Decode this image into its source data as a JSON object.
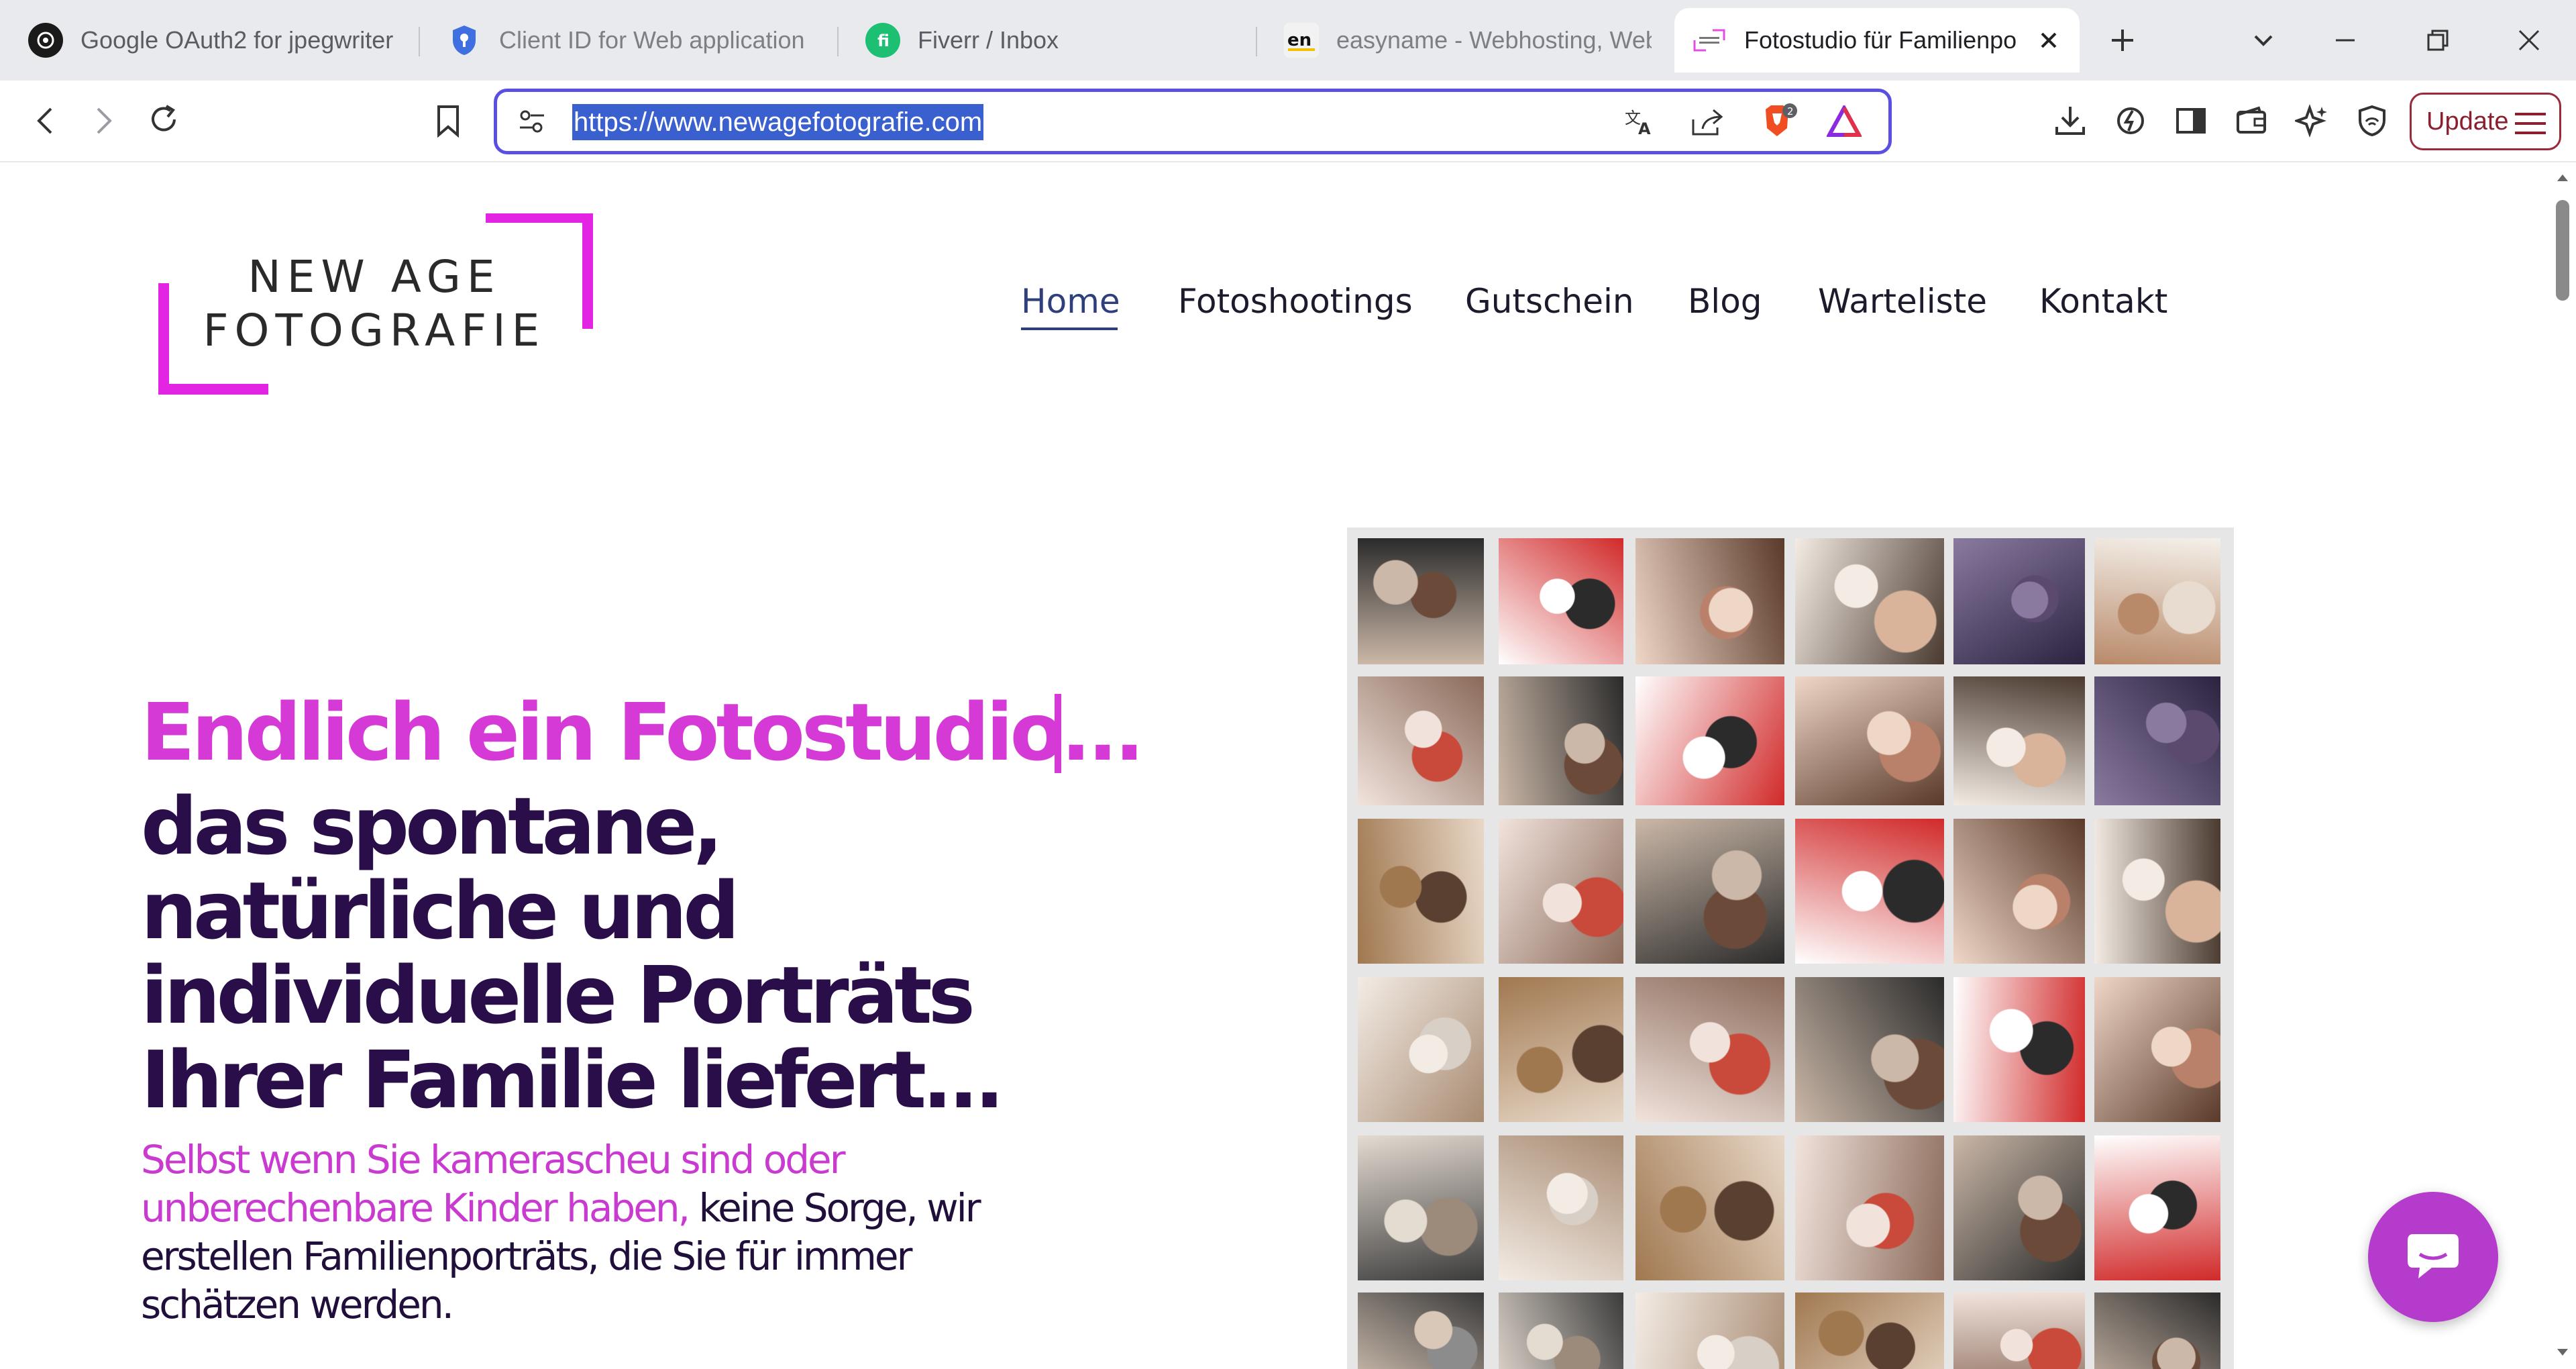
{
  "browser": {
    "tabs": [
      {
        "title": "Google OAuth2 for jpegwriter",
        "icon": "openai-icon"
      },
      {
        "title": "Client ID for Web application",
        "icon": "shield-icon"
      },
      {
        "title": "Fiverr / Inbox",
        "icon": "fiverr-icon"
      },
      {
        "title": "easyname - Webhosting, Web",
        "icon": "easyname-icon"
      },
      {
        "title": "Fotostudio für Familienpo",
        "icon": "newage-icon",
        "active": true
      }
    ],
    "url": "https://www.newagefotografie.com",
    "update_label": "Update",
    "brave_badge": "2"
  },
  "site": {
    "logo_line1": "NEW AGE",
    "logo_line2": "FOTOGRAFIE",
    "nav": [
      "Home",
      "Fotoshootings",
      "Gutschein",
      "Blog",
      "Warteliste",
      "Kontakt"
    ],
    "active_nav": "Home",
    "hero_pink": "Endlich ein Fotostudio...",
    "hero_lines": [
      "das spontane,",
      "natürliche und",
      "individuelle Porträts",
      "Ihrer Familie liefert..."
    ],
    "sub_pink_1": "Selbst wenn Sie kamerascheu sind oder",
    "sub_pink_2": "unberechenbare Kinder haben,",
    "sub_dark_2": " keine Sorge, wir",
    "sub_dark_3": "erstellen Familienporträts, die Sie für immer",
    "sub_dark_4": "schätzen werden."
  },
  "colors": {
    "brand_pink": "#d63ad6",
    "brand_dark": "#2a0e4a",
    "nav_active": "#2e3f7c",
    "chat_button": "#b53bcc",
    "url_highlight": "#3a5fcf"
  }
}
